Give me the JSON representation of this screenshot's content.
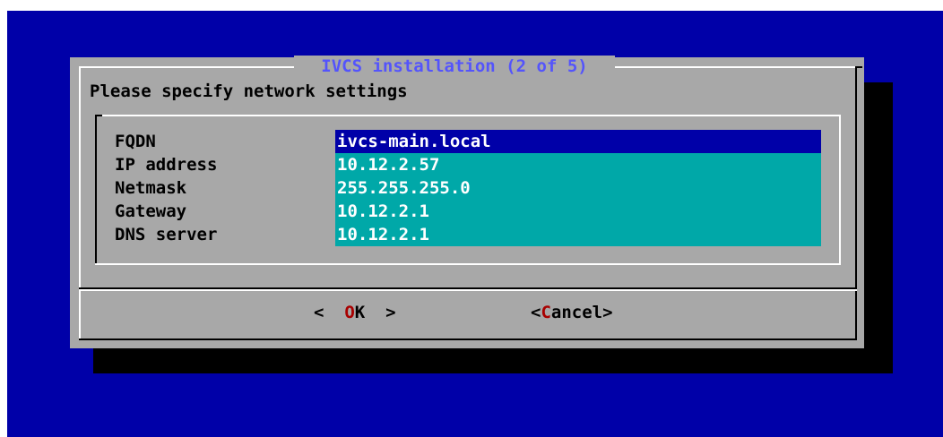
{
  "dialog": {
    "title": "IVCS installation (2 of 5)",
    "prompt": "Please specify network settings"
  },
  "fields": [
    {
      "label": "FQDN",
      "value": "ivcs-main.local"
    },
    {
      "label": "IP address",
      "value": "10.12.2.57"
    },
    {
      "label": "Netmask",
      "value": "255.255.255.0"
    },
    {
      "label": "Gateway",
      "value": "10.12.2.1"
    },
    {
      "label": "DNS server",
      "value": "10.12.2.1"
    }
  ],
  "buttons": {
    "ok_left": "< ",
    "ok_hot": "O",
    "ok_rest": "K",
    "ok_right": " >",
    "cancel_left": "<",
    "cancel_hot": "C",
    "cancel_rest": "ancel",
    "cancel_right": ">"
  },
  "colors": {
    "background": "#0000a8",
    "dialog": "#a8a8a8",
    "field": "#00a8a8",
    "active_field": "#0000a8",
    "title": "#5454fc",
    "hotkey": "#a80000"
  }
}
